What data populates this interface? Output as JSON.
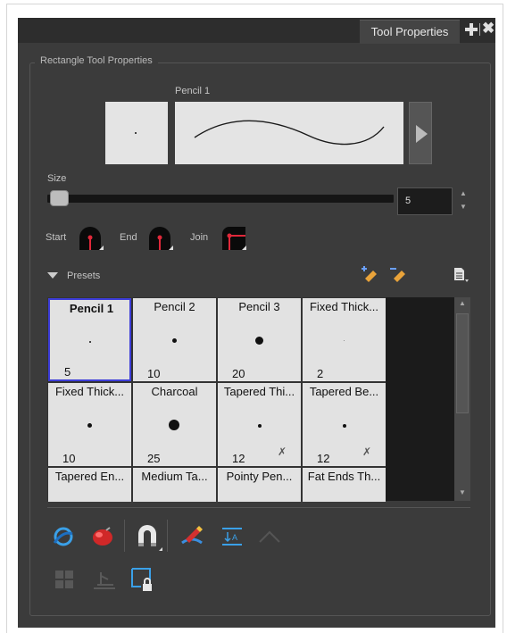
{
  "panel": {
    "tab_label": "Tool Properties",
    "add_icon": "plus-icon",
    "close_icon": "close-icon",
    "close_glyph": "✖",
    "group_title": "Rectangle Tool Properties"
  },
  "brush_preview": {
    "name": "Pencil 1"
  },
  "size": {
    "label": "Size",
    "value": "5",
    "slider_fraction": 0.05
  },
  "caps": {
    "start_label": "Start",
    "end_label": "End",
    "join_label": "Join"
  },
  "presets": {
    "label": "Presets",
    "new_icon": "new-preset-icon",
    "delete_icon": "delete-preset-icon",
    "menu_icon": "presets-menu-icon",
    "selected": "Pencil 1",
    "items": [
      {
        "name": "Pencil 1",
        "size": "5"
      },
      {
        "name": "Pencil 2",
        "size": "10"
      },
      {
        "name": "Pencil 3",
        "size": "20"
      },
      {
        "name": "Fixed Thick...",
        "size": "2"
      },
      {
        "name": "Fixed Thick...",
        "size": "10"
      },
      {
        "name": "Charcoal",
        "size": "25"
      },
      {
        "name": "Tapered Thi...",
        "size": "12"
      },
      {
        "name": "Tapered Be...",
        "size": "12"
      },
      {
        "name": "Tapered En...",
        "size": ""
      },
      {
        "name": "Medium Ta...",
        "size": ""
      },
      {
        "name": "Pointy Pen...",
        "size": ""
      },
      {
        "name": "Fat Ends Th...",
        "size": ""
      }
    ]
  },
  "toolbar": {
    "row1": [
      "auto-flatten-icon",
      "auto-create-color-art-icon",
      "snap-to-contour-icon",
      "auto-fill-icon",
      "arrange-icon",
      "invisible-lines-icon"
    ],
    "row2": [
      "grid-icon",
      "match-camera-icon",
      "lock-icon"
    ]
  },
  "colors": {
    "panel_bg": "#3b3b3b",
    "selection": "#3d3dd9",
    "cap_red": "#e0283a"
  }
}
